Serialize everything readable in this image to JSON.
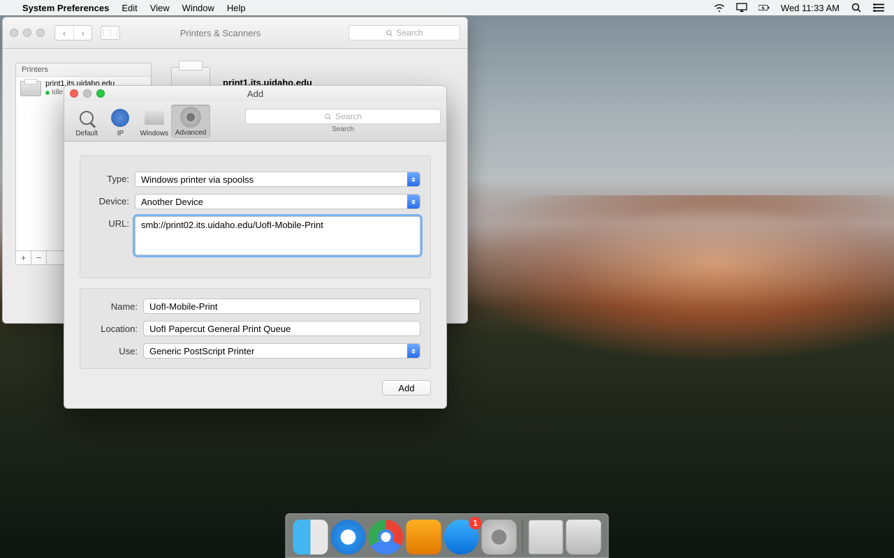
{
  "menubar": {
    "app_name": "System Preferences",
    "items": [
      "Edit",
      "View",
      "Window",
      "Help"
    ],
    "time": "Wed 11:33 AM"
  },
  "printers_window": {
    "title": "Printers & Scanners",
    "search_placeholder": "Search",
    "sidebar_heading": "Printers",
    "printer_item": {
      "name": "print1.its.uidaho.edu",
      "status": "Idle"
    },
    "main_title": "print1.its.uidaho.edu"
  },
  "add_window": {
    "title": "Add",
    "toolbar": {
      "default": "Default",
      "ip": "IP",
      "windows": "Windows",
      "advanced": "Advanced"
    },
    "search_placeholder": "Search",
    "search_label": "Search",
    "form": {
      "type_label": "Type:",
      "type_value": "Windows printer via spoolss",
      "device_label": "Device:",
      "device_value": "Another Device",
      "url_label": "URL:",
      "url_value": "smb://print02.its.uidaho.edu/UofI-Mobile-Print",
      "name_label": "Name:",
      "name_value": "UofI-Mobile-Print",
      "location_label": "Location:",
      "location_value": "UofI Papercut General Print Queue",
      "use_label": "Use:",
      "use_value": "Generic PostScript Printer"
    },
    "add_button": "Add"
  },
  "dock": {
    "badge": "1"
  }
}
